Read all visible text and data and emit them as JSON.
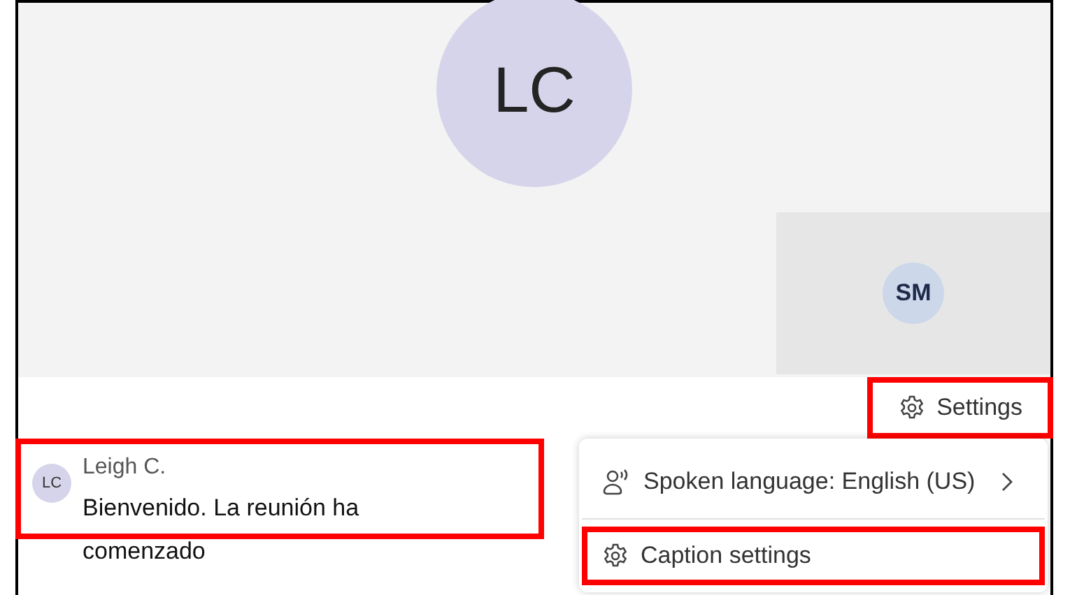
{
  "stage": {
    "main_participant": {
      "initials": "LC"
    },
    "tile": {
      "initials": "SM"
    }
  },
  "settings_button": {
    "label": "Settings",
    "highlighted": true
  },
  "caption": {
    "initials": "LC",
    "speaker": "Leigh C.",
    "text": "Bienvenido. La reunión ha comenzado",
    "highlighted": true
  },
  "menu": {
    "items": [
      {
        "kind": "submenu",
        "label": "Spoken language: English (US)",
        "highlighted": false
      },
      {
        "kind": "action",
        "label": "Caption settings",
        "highlighted": true
      }
    ]
  }
}
